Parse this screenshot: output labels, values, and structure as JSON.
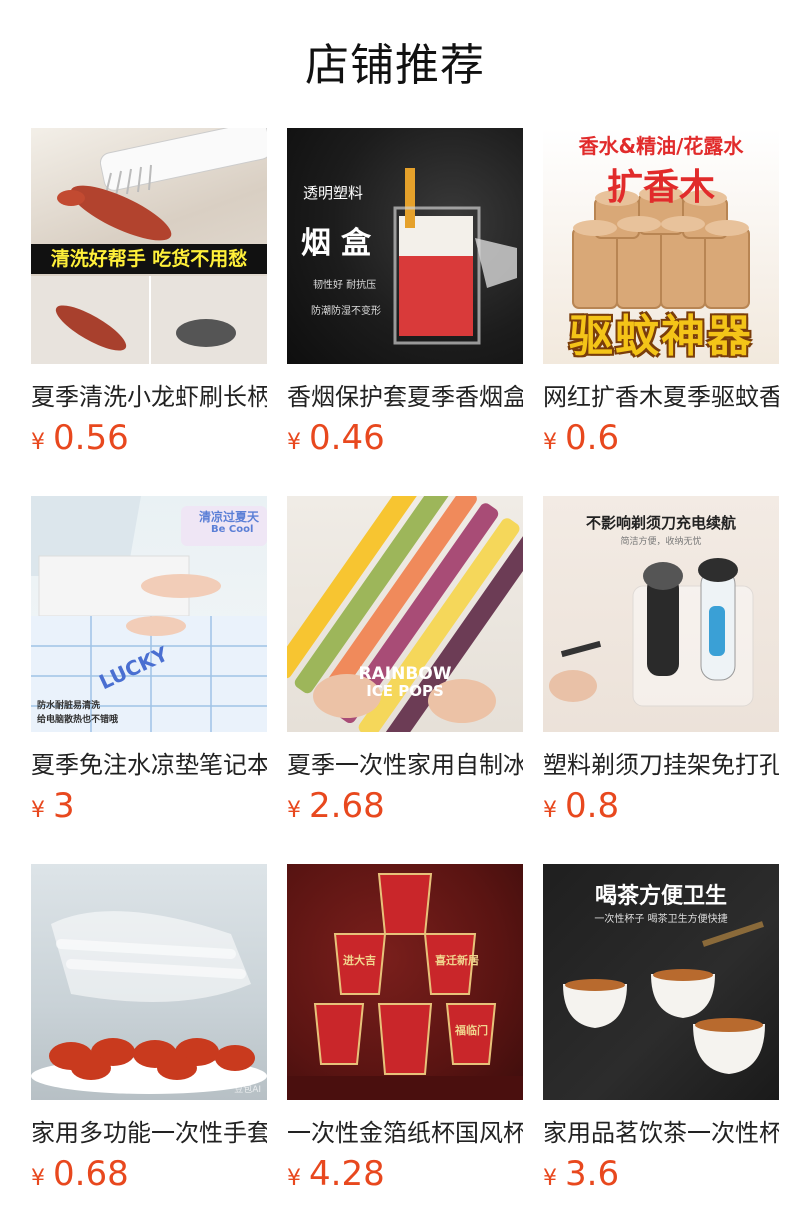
{
  "section_title": "店铺推荐",
  "currency_symbol": "¥",
  "colors": {
    "price": "#e8481e",
    "title": "#111111",
    "name": "#222222"
  },
  "products": [
    {
      "name": "夏季清洗小龙虾刷长柄",
      "price": "0.56",
      "image_text": [
        "清洗好帮手 吃货不用愁"
      ]
    },
    {
      "name": "香烟保护套夏季香烟盒",
      "price": "0.46",
      "image_text": [
        "透明塑料",
        "烟盒",
        "韧性好 耐抗压",
        "防潮防湿不变形"
      ]
    },
    {
      "name": "网红扩香木夏季驱蚊香",
      "price": "0.6",
      "image_text": [
        "香水&精油/花露水",
        "扩香木",
        "驱蚊神器"
      ]
    },
    {
      "name": "夏季免注水凉垫笔记本",
      "price": "3",
      "image_text": [
        "清凉过夏天",
        "Be Cool",
        "LUCKY",
        "防水耐脏易清洗",
        "给电脑散热也不错哦"
      ]
    },
    {
      "name": "夏季一次性家用自制冰",
      "price": "2.68",
      "image_text": [
        "RAINBOW",
        "ICE POPS"
      ]
    },
    {
      "name": "塑料剃须刀挂架免打孔",
      "price": "0.8",
      "image_text": [
        "不影响剃须刀充电续航",
        "简洁方便，收纳无忧"
      ]
    },
    {
      "name": "家用多功能一次性手套",
      "price": "0.68",
      "image_text": [
        "豆包AI"
      ]
    },
    {
      "name": "一次性金箔纸杯国风杯",
      "price": "4.28",
      "image_text": [
        "喜迁新居",
        "进大吉",
        "福临门"
      ]
    },
    {
      "name": "家用品茗饮茶一次性杯",
      "price": "3.6",
      "image_text": [
        "喝茶方便卫生",
        "一次性杯子 喝茶卫生方便快捷"
      ]
    }
  ]
}
